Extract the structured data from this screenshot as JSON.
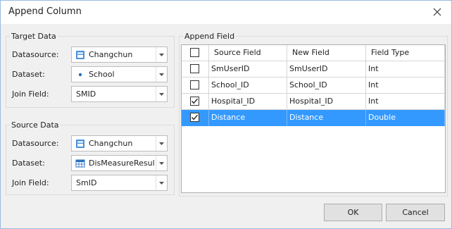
{
  "window": {
    "title": "Append Column"
  },
  "target_data": {
    "title": "Target Data",
    "datasource_label": "Datasource:",
    "datasource_value": "Changchun",
    "dataset_label": "Dataset:",
    "dataset_value": "School",
    "join_field_label": "Join Field:",
    "join_field_value": "SMID"
  },
  "source_data": {
    "title": "Source Data",
    "datasource_label": "Datasource:",
    "datasource_value": "Changchun",
    "dataset_label": "Dataset:",
    "dataset_value": "DisMeasureResult_",
    "join_field_label": "Join Field:",
    "join_field_value": "SmID"
  },
  "append_field": {
    "title": "Append Field",
    "columns": [
      "Source Field",
      "New Field",
      "Field Type"
    ],
    "rows": [
      {
        "checked": false,
        "source": "SmUserID",
        "new": "SmUserID",
        "type": "Int"
      },
      {
        "checked": false,
        "source": "School_ID",
        "new": "School_ID",
        "type": "Int"
      },
      {
        "checked": true,
        "source": "Hospital_ID",
        "new": "Hospital_ID",
        "type": "Int"
      },
      {
        "checked": true,
        "source": "Distance",
        "new": "Distance",
        "type": "Double",
        "selected": true
      }
    ]
  },
  "buttons": {
    "ok": "OK",
    "cancel": "Cancel"
  },
  "colors": {
    "selection": "#3399ff",
    "title_bar": "#ffffff",
    "dialog_bg": "#f0f0f0"
  },
  "icons": {
    "close": "close-icon",
    "datasource": "database-icon",
    "point_dataset": "point-dataset-icon",
    "tabular_dataset": "table-dataset-icon",
    "dropdown": "chevron-down-icon"
  }
}
